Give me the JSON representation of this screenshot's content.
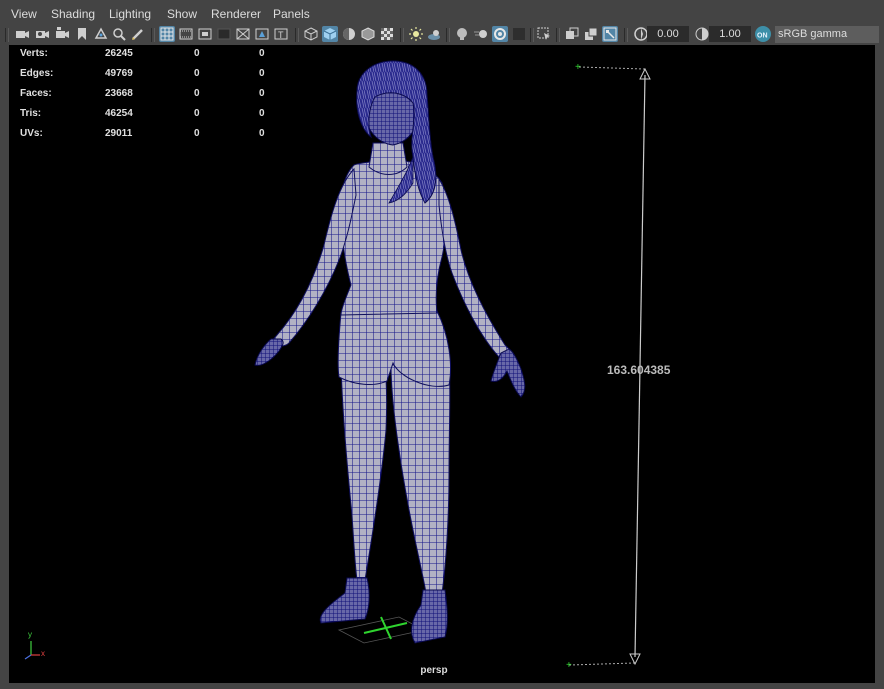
{
  "menu": {
    "view": "View",
    "shading": "Shading",
    "lighting": "Lighting",
    "show": "Show",
    "renderer": "Renderer",
    "panels": "Panels"
  },
  "toolbar": {
    "exposure_value": "0.00",
    "gamma_value": "1.00",
    "color_space": "sRGB gamma",
    "icons": [
      "select-camera-icon",
      "camera-attributes-icon",
      "bookmark-icon",
      "image-plane-icon",
      "2d-pan-zoom-icon",
      "grease-pencil-icon",
      "grid-icon",
      "film-gate-icon",
      "resolution-gate-icon",
      "gate-mask-icon",
      "field-chart-icon",
      "safe-action-icon",
      "safe-title-icon",
      "wireframe-icon",
      "smooth-shade-icon",
      "wireframe-on-shaded-icon",
      "default-material-icon",
      "textured-icon",
      "lights-icon",
      "shadows-icon",
      "screen-space-ao-icon",
      "motion-blur-icon",
      "anti-aliasing-icon",
      "depth-of-field-icon",
      "isolate-select-icon",
      "xray-icon",
      "xray-joints-icon",
      "xray-components-icon",
      "exposure-icon",
      "gamma-icon",
      "color-management-icon"
    ]
  },
  "hud": {
    "rows": [
      {
        "label": "Verts:",
        "total": "26245",
        "selected": "0",
        "component": "0"
      },
      {
        "label": "Edges:",
        "total": "49769",
        "selected": "0",
        "component": "0"
      },
      {
        "label": "Faces:",
        "total": "23668",
        "selected": "0",
        "component": "0"
      },
      {
        "label": "Tris:",
        "total": "46254",
        "selected": "0",
        "component": "0"
      },
      {
        "label": "UVs:",
        "total": "29011",
        "selected": "0",
        "component": "0"
      }
    ]
  },
  "viewport": {
    "camera": "persp",
    "measurement": "163.604385",
    "axis": {
      "x": "x",
      "y": "y"
    },
    "colors": {
      "wireframe": "#1a1a8c",
      "shaded": "#b4b4c4",
      "background": "#000000",
      "grid_axis": "#2fd42f"
    }
  }
}
